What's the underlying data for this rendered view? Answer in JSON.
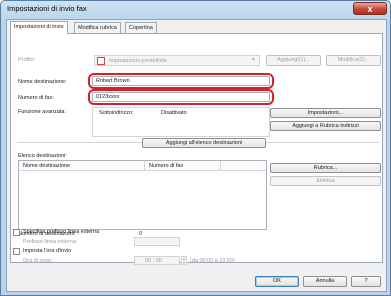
{
  "window": {
    "title": "Impostazioni di invio fax",
    "close": "x"
  },
  "tabs": [
    {
      "label": "Impostazioni di invio"
    },
    {
      "label": "Modifica rubrica"
    },
    {
      "label": "Copertina"
    }
  ],
  "profile": {
    "label": "Profilo:",
    "value": "Impostazioni predefinite",
    "add_button": "Aggiungi(1)...",
    "edit_button": "Modifica(2)..."
  },
  "recipient_name": {
    "label": "Nome destinazione:",
    "value": "Robert Brown"
  },
  "fax_number": {
    "label": "Numero di fax:",
    "value": "0123xxxx"
  },
  "functions": {
    "label": "Funzione avanzata:",
    "sub_address": "Sottoindirizzo:",
    "status": "Disattivato"
  },
  "buttons": {
    "settings": "Impostazioni...",
    "add_to_book": "Aggiungi a Rubrica indirizzi",
    "add_to_list": "Aggiungi all'elenco destinazioni",
    "address_book": "Rubrica...",
    "delete": "Elimina",
    "ok": "OK",
    "cancel": "Annulla",
    "help": "?"
  },
  "destinations": {
    "label": "Elenco destinazioni:",
    "columns": [
      "Nome destinazione",
      "Numero di fax"
    ],
    "count_label": "Numero di destinazioni:",
    "count_value": "0"
  },
  "external_line": {
    "checkbox_label": "Specifica prefisso linea esterna",
    "prefix_label": "Prefisso linea esterna:",
    "prefix_value": ""
  },
  "send_time": {
    "checkbox_label": "Imposta l'ora d'invio",
    "time_label": "Ora di invio:",
    "time_value": "00 : 00",
    "range": "(da 00:00 a 23:59)"
  }
}
